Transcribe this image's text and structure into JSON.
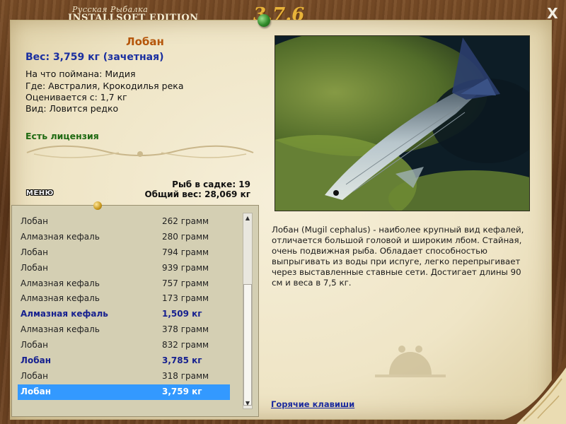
{
  "window": {
    "title_small": "Русская Рыбалка",
    "title_main": "INSTALLSOFT EDITION",
    "version": "3.7.6",
    "close_label": "X"
  },
  "catch": {
    "name": "Лобан",
    "weight_line": "Вес: 3,759 кг (зачетная)",
    "bait_line": "На что поймана: Мидия",
    "place_line": "Где: Австралия, Крокодилья река",
    "threshold_line": "Оценивается с: 1,7 кг",
    "kind_line": "Вид: Ловится редко",
    "license": "Есть лицензия"
  },
  "stats": {
    "count_line": "Рыб в садке: 19",
    "total_line": "Общий вес: 28,069 кг"
  },
  "menu_label": "МЕНЮ",
  "fish_list": [
    {
      "name": "Лобан",
      "weight": "262 грамм",
      "trophy": false,
      "selected": false
    },
    {
      "name": "Алмазная кефаль",
      "weight": "280 грамм",
      "trophy": false,
      "selected": false
    },
    {
      "name": "Лобан",
      "weight": "794 грамм",
      "trophy": false,
      "selected": false
    },
    {
      "name": "Лобан",
      "weight": "939 грамм",
      "trophy": false,
      "selected": false
    },
    {
      "name": "Алмазная кефаль",
      "weight": "757 грамм",
      "trophy": false,
      "selected": false
    },
    {
      "name": "Алмазная кефаль",
      "weight": "173 грамм",
      "trophy": false,
      "selected": false
    },
    {
      "name": "Алмазная кефаль",
      "weight": "1,509 кг",
      "trophy": true,
      "selected": false
    },
    {
      "name": "Алмазная кефаль",
      "weight": "378 грамм",
      "trophy": false,
      "selected": false
    },
    {
      "name": "Лобан",
      "weight": "832 грамм",
      "trophy": false,
      "selected": false
    },
    {
      "name": "Лобан",
      "weight": "3,785 кг",
      "trophy": true,
      "selected": false
    },
    {
      "name": "Лобан",
      "weight": "318 грамм",
      "trophy": false,
      "selected": false
    },
    {
      "name": "Лобан",
      "weight": "3,759 кг",
      "trophy": true,
      "selected": true
    }
  ],
  "description": "Лобан (Mugil cephalus) - наиболее крупный вид кефалей, отличается большой головой и широким лбом. Стайная, очень подвижная рыба. Обладает способностью выпрыгивать из воды при испуге, легко перепрыгивает через выставленные ставные сети. Достигает длины 90 см и веса в 7,5 кг.",
  "hotkeys_label": "Горячие клавиши",
  "colors": {
    "fish_name": "#b5560b",
    "weight": "#1a2fa0",
    "license": "#1f6a12",
    "trophy": "#16208f",
    "selection": "#3399ff"
  },
  "icons": {
    "close": "close-icon",
    "pin": "pushpin-icon",
    "scroll_up": "arrow-up-icon",
    "scroll_down": "arrow-down-icon"
  }
}
